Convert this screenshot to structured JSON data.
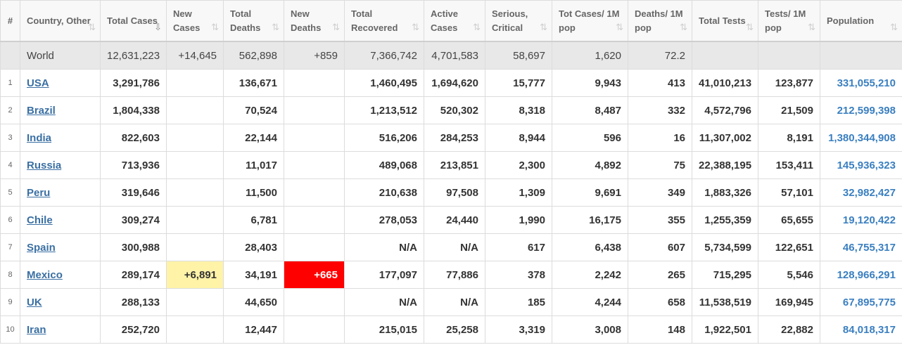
{
  "headers": [
    {
      "key": "rank",
      "label": "#"
    },
    {
      "key": "country",
      "label": "Country, Other"
    },
    {
      "key": "total_cases",
      "label": "Total Cases"
    },
    {
      "key": "new_cases",
      "label": "New Cases"
    },
    {
      "key": "total_deaths",
      "label": "Total Deaths"
    },
    {
      "key": "new_deaths",
      "label": "New Deaths"
    },
    {
      "key": "total_recovered",
      "label": "Total Recovered"
    },
    {
      "key": "active_cases",
      "label": "Active Cases"
    },
    {
      "key": "serious",
      "label": "Serious, Critical"
    },
    {
      "key": "cases_per_m",
      "label": "Tot Cases/ 1M pop"
    },
    {
      "key": "deaths_per_m",
      "label": "Deaths/ 1M pop"
    },
    {
      "key": "total_tests",
      "label": "Total Tests"
    },
    {
      "key": "tests_per_m",
      "label": "Tests/ 1M pop"
    },
    {
      "key": "population",
      "label": "Population"
    }
  ],
  "sort_icon": "sort-arrows-icon",
  "active_sort_icon": "sort-descending-icon",
  "world": {
    "country": "World",
    "total_cases": "12,631,223",
    "new_cases": "+14,645",
    "total_deaths": "562,898",
    "new_deaths": "+859",
    "total_recovered": "7,366,742",
    "active_cases": "4,701,583",
    "serious": "58,697",
    "cases_per_m": "1,620",
    "deaths_per_m": "72.2",
    "total_tests": "",
    "tests_per_m": "",
    "population": ""
  },
  "rows": [
    {
      "rank": "1",
      "country": "USA",
      "total_cases": "3,291,786",
      "new_cases": "",
      "total_deaths": "136,671",
      "new_deaths": "",
      "total_recovered": "1,460,495",
      "active_cases": "1,694,620",
      "serious": "15,777",
      "cases_per_m": "9,943",
      "deaths_per_m": "413",
      "total_tests": "41,010,213",
      "tests_per_m": "123,877",
      "population": "331,055,210"
    },
    {
      "rank": "2",
      "country": "Brazil",
      "total_cases": "1,804,338",
      "new_cases": "",
      "total_deaths": "70,524",
      "new_deaths": "",
      "total_recovered": "1,213,512",
      "active_cases": "520,302",
      "serious": "8,318",
      "cases_per_m": "8,487",
      "deaths_per_m": "332",
      "total_tests": "4,572,796",
      "tests_per_m": "21,509",
      "population": "212,599,398"
    },
    {
      "rank": "3",
      "country": "India",
      "total_cases": "822,603",
      "new_cases": "",
      "total_deaths": "22,144",
      "new_deaths": "",
      "total_recovered": "516,206",
      "active_cases": "284,253",
      "serious": "8,944",
      "cases_per_m": "596",
      "deaths_per_m": "16",
      "total_tests": "11,307,002",
      "tests_per_m": "8,191",
      "population": "1,380,344,908"
    },
    {
      "rank": "4",
      "country": "Russia",
      "total_cases": "713,936",
      "new_cases": "",
      "total_deaths": "11,017",
      "new_deaths": "",
      "total_recovered": "489,068",
      "active_cases": "213,851",
      "serious": "2,300",
      "cases_per_m": "4,892",
      "deaths_per_m": "75",
      "total_tests": "22,388,195",
      "tests_per_m": "153,411",
      "population": "145,936,323"
    },
    {
      "rank": "5",
      "country": "Peru",
      "total_cases": "319,646",
      "new_cases": "",
      "total_deaths": "11,500",
      "new_deaths": "",
      "total_recovered": "210,638",
      "active_cases": "97,508",
      "serious": "1,309",
      "cases_per_m": "9,691",
      "deaths_per_m": "349",
      "total_tests": "1,883,326",
      "tests_per_m": "57,101",
      "population": "32,982,427"
    },
    {
      "rank": "6",
      "country": "Chile",
      "total_cases": "309,274",
      "new_cases": "",
      "total_deaths": "6,781",
      "new_deaths": "",
      "total_recovered": "278,053",
      "active_cases": "24,440",
      "serious": "1,990",
      "cases_per_m": "16,175",
      "deaths_per_m": "355",
      "total_tests": "1,255,359",
      "tests_per_m": "65,655",
      "population": "19,120,422"
    },
    {
      "rank": "7",
      "country": "Spain",
      "total_cases": "300,988",
      "new_cases": "",
      "total_deaths": "28,403",
      "new_deaths": "",
      "total_recovered": "N/A",
      "active_cases": "N/A",
      "serious": "617",
      "cases_per_m": "6,438",
      "deaths_per_m": "607",
      "total_tests": "5,734,599",
      "tests_per_m": "122,651",
      "population": "46,755,317"
    },
    {
      "rank": "8",
      "country": "Mexico",
      "total_cases": "289,174",
      "new_cases": "+6,891",
      "total_deaths": "34,191",
      "new_deaths": "+665",
      "total_recovered": "177,097",
      "active_cases": "77,886",
      "serious": "378",
      "cases_per_m": "2,242",
      "deaths_per_m": "265",
      "total_tests": "715,295",
      "tests_per_m": "5,546",
      "population": "128,966,291"
    },
    {
      "rank": "9",
      "country": "UK",
      "total_cases": "288,133",
      "new_cases": "",
      "total_deaths": "44,650",
      "new_deaths": "",
      "total_recovered": "N/A",
      "active_cases": "N/A",
      "serious": "185",
      "cases_per_m": "4,244",
      "deaths_per_m": "658",
      "total_tests": "11,538,519",
      "tests_per_m": "169,945",
      "population": "67,895,775"
    },
    {
      "rank": "10",
      "country": "Iran",
      "total_cases": "252,720",
      "new_cases": "",
      "total_deaths": "12,447",
      "new_deaths": "",
      "total_recovered": "215,015",
      "active_cases": "25,258",
      "serious": "3,319",
      "cases_per_m": "3,008",
      "deaths_per_m": "148",
      "total_tests": "1,922,501",
      "tests_per_m": "22,882",
      "population": "84,018,317"
    }
  ],
  "colors": {
    "new_cases_highlight": "#fff3a8",
    "new_deaths_highlight": "#ff0000",
    "link": "#3a6fa3",
    "population_text": "#3a7fc0",
    "world_row_bg": "#e8e8e8"
  }
}
